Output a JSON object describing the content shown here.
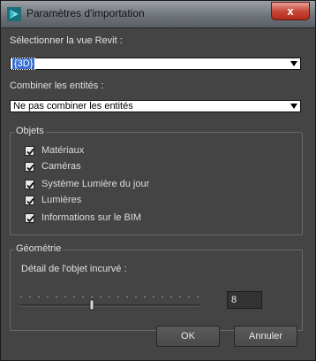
{
  "window": {
    "title": "Paramètres d'importation",
    "close_label": "x"
  },
  "revit_view": {
    "label": "Sélectionner la vue Revit :",
    "value": "{3D}"
  },
  "combine": {
    "label": "Combiner les entités :",
    "value": "Ne pas combiner les entités"
  },
  "objects": {
    "title": "Objets",
    "items": [
      {
        "label": "Matériaux",
        "checked": true
      },
      {
        "label": "Caméras",
        "checked": true
      },
      {
        "label": "Système Lumière du jour",
        "checked": true
      },
      {
        "label": "Lumières",
        "checked": true
      },
      {
        "label": "Informations sur le BIM",
        "checked": true
      }
    ]
  },
  "geometry": {
    "title": "Géométrie",
    "curve_label": "Détail de l'objet incurvé :",
    "curve_value": "8",
    "curve_min": 0,
    "curve_max": 20,
    "curve_level": 8
  },
  "buttons": {
    "ok": "OK",
    "cancel": "Annuler"
  },
  "colors": {
    "background": "#444444",
    "selection": "#3a6fd1",
    "close_button": "#c9493a"
  }
}
